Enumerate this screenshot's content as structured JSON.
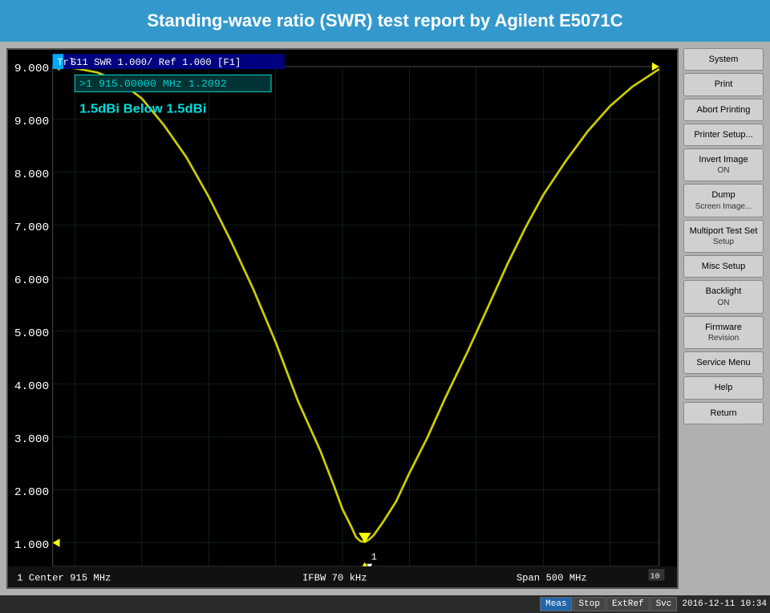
{
  "title": "Standing-wave ratio (SWR) test report by Agilent E5071C",
  "chart": {
    "header": "Trl  S11  SWR 1.000/ Ref 1.000 [F1]",
    "marker": ">1   915.00000 MHz   1.2092",
    "annotation": "1.5dBi Below 1.5dBi",
    "y_labels": [
      {
        "value": "9.000",
        "pct": 8
      },
      {
        "value": "8.000",
        "pct": 19
      },
      {
        "value": "7.000",
        "pct": 30
      },
      {
        "value": "6.000",
        "pct": 41
      },
      {
        "value": "5.000",
        "pct": 52
      },
      {
        "value": "4.000",
        "pct": 63
      },
      {
        "value": "3.000",
        "pct": 74
      },
      {
        "value": "2.000",
        "pct": 85
      },
      {
        "value": "1.000",
        "pct": 94
      }
    ],
    "bottom_left": "1  Center 915 MHz",
    "bottom_center": "IFBW 70 kHz",
    "bottom_right": "Span 500 MHz"
  },
  "right_panel": {
    "buttons": [
      {
        "label": "System",
        "sub": ""
      },
      {
        "label": "Print",
        "sub": ""
      },
      {
        "label": "Abort Printing",
        "sub": ""
      },
      {
        "label": "Printer Setup...",
        "sub": ""
      },
      {
        "label": "Invert Image\nON",
        "sub": "ON"
      },
      {
        "label": "Dump\nScreen Image...",
        "sub": ""
      },
      {
        "label": "Multiport Test Set\nSetup",
        "sub": ""
      },
      {
        "label": "Misc Setup",
        "sub": ""
      },
      {
        "label": "Backlight\nON",
        "sub": "ON"
      },
      {
        "label": "Firmware\nRevision",
        "sub": ""
      },
      {
        "label": "Service Menu",
        "sub": ""
      },
      {
        "label": "Help",
        "sub": ""
      },
      {
        "label": "Return",
        "sub": ""
      }
    ]
  },
  "status_strip": {
    "items": [
      {
        "label": "Meas",
        "active": true
      },
      {
        "label": "Stop",
        "active": false
      },
      {
        "label": "ExtRef",
        "active": false
      },
      {
        "label": "Svc",
        "active": false
      }
    ],
    "datetime": "2016-12-11 10:34"
  }
}
